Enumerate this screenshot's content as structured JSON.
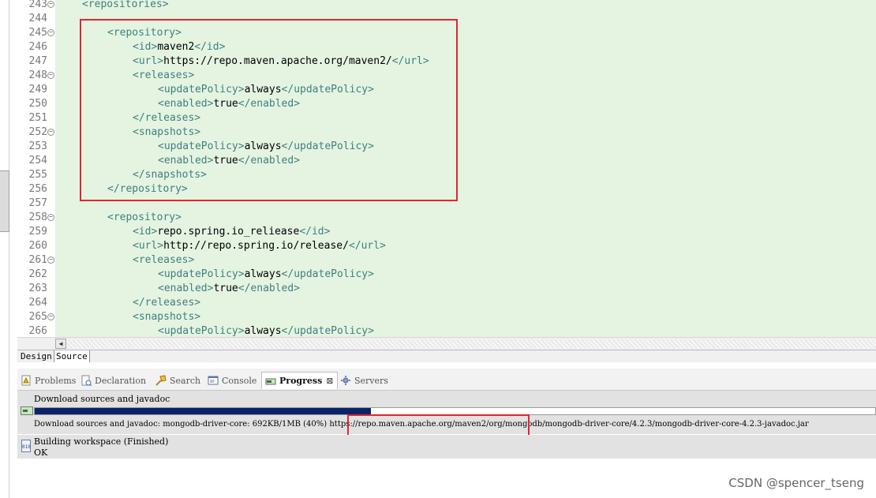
{
  "editor": {
    "lines": [
      {
        "n": "243",
        "fold": true,
        "indent": 0,
        "parts": [
          [
            "tag",
            "<repositories>"
          ]
        ]
      },
      {
        "n": "244",
        "fold": false,
        "indent": 0,
        "parts": []
      },
      {
        "n": "245",
        "fold": true,
        "indent": 1,
        "parts": [
          [
            "tag",
            "<repository>"
          ]
        ]
      },
      {
        "n": "246",
        "fold": false,
        "indent": 2,
        "parts": [
          [
            "tag",
            "<id>"
          ],
          [
            "txt",
            "maven2"
          ],
          [
            "tag",
            "</id>"
          ]
        ]
      },
      {
        "n": "247",
        "fold": false,
        "indent": 2,
        "parts": [
          [
            "tag",
            "<url>"
          ],
          [
            "txt",
            "https://repo.maven.apache.org/maven2/"
          ],
          [
            "tag",
            "</url>"
          ]
        ]
      },
      {
        "n": "248",
        "fold": true,
        "indent": 2,
        "parts": [
          [
            "tag",
            "<releases>"
          ]
        ]
      },
      {
        "n": "249",
        "fold": false,
        "indent": 3,
        "parts": [
          [
            "tag",
            "<updatePolicy>"
          ],
          [
            "txt",
            "always"
          ],
          [
            "tag",
            "</updatePolicy>"
          ]
        ]
      },
      {
        "n": "250",
        "fold": false,
        "indent": 3,
        "parts": [
          [
            "tag",
            "<enabled>"
          ],
          [
            "txt",
            "true"
          ],
          [
            "tag",
            "</enabled>"
          ]
        ]
      },
      {
        "n": "251",
        "fold": false,
        "indent": 2,
        "parts": [
          [
            "tag",
            "</releases>"
          ]
        ]
      },
      {
        "n": "252",
        "fold": true,
        "indent": 2,
        "parts": [
          [
            "tag",
            "<snapshots>"
          ]
        ]
      },
      {
        "n": "253",
        "fold": false,
        "indent": 3,
        "parts": [
          [
            "tag",
            "<updatePolicy>"
          ],
          [
            "txt",
            "always"
          ],
          [
            "tag",
            "</updatePolicy>"
          ]
        ]
      },
      {
        "n": "254",
        "fold": false,
        "indent": 3,
        "parts": [
          [
            "tag",
            "<enabled>"
          ],
          [
            "txt",
            "true"
          ],
          [
            "tag",
            "</enabled>"
          ]
        ]
      },
      {
        "n": "255",
        "fold": false,
        "indent": 2,
        "parts": [
          [
            "tag",
            "</snapshots>"
          ]
        ]
      },
      {
        "n": "256",
        "fold": false,
        "indent": 1,
        "parts": [
          [
            "tag",
            "</repository>"
          ]
        ]
      },
      {
        "n": "257",
        "fold": false,
        "indent": 0,
        "parts": []
      },
      {
        "n": "258",
        "fold": true,
        "indent": 1,
        "parts": [
          [
            "tag",
            "<repository>"
          ]
        ]
      },
      {
        "n": "259",
        "fold": false,
        "indent": 2,
        "parts": [
          [
            "tag",
            "<id>"
          ],
          [
            "txt",
            "repo.spring.io_reliease"
          ],
          [
            "tag",
            "</id>"
          ]
        ]
      },
      {
        "n": "260",
        "fold": false,
        "indent": 2,
        "parts": [
          [
            "tag",
            "<url>"
          ],
          [
            "txt",
            "http://repo.spring.io/release/"
          ],
          [
            "tag",
            "</url>"
          ]
        ]
      },
      {
        "n": "261",
        "fold": true,
        "indent": 2,
        "parts": [
          [
            "tag",
            "<releases>"
          ]
        ]
      },
      {
        "n": "262",
        "fold": false,
        "indent": 3,
        "parts": [
          [
            "tag",
            "<updatePolicy>"
          ],
          [
            "txt",
            "always"
          ],
          [
            "tag",
            "</updatePolicy>"
          ]
        ]
      },
      {
        "n": "263",
        "fold": false,
        "indent": 3,
        "parts": [
          [
            "tag",
            "<enabled>"
          ],
          [
            "txt",
            "true"
          ],
          [
            "tag",
            "</enabled>"
          ]
        ]
      },
      {
        "n": "264",
        "fold": false,
        "indent": 2,
        "parts": [
          [
            "tag",
            "</releases>"
          ]
        ]
      },
      {
        "n": "265",
        "fold": true,
        "indent": 2,
        "parts": [
          [
            "tag",
            "<snapshots>"
          ]
        ]
      },
      {
        "n": "266",
        "fold": false,
        "indent": 3,
        "parts": [
          [
            "tag",
            "<updatePolicy>"
          ],
          [
            "txt",
            "always"
          ],
          [
            "tag",
            "</updatePolicy>"
          ]
        ]
      }
    ]
  },
  "editor_tabs": {
    "design": "Design",
    "source": "Source"
  },
  "views": {
    "problems": "Problems",
    "declaration": "Declaration",
    "search": "Search",
    "console": "Console",
    "progress": "Progress",
    "progress_close": "⊠",
    "servers": "Servers"
  },
  "progress": {
    "job1_title": "Download sources and javadoc",
    "job1_progress": 0.4,
    "job1_status": "Download sources and javadoc: mongodb-driver-core: 692KB/1MB (40%) https://repo.maven.apache.org/maven2/org/mongodb/mongodb-driver-core/4.2.3/mongodb-driver-core-4.2.3-javadoc.jar",
    "job2_icon_text": "010",
    "job2_title": "Building workspace (Finished)",
    "job2_status": "OK"
  },
  "watermark": "CSDN @spencer_tseng",
  "colors": {
    "editor_bg": "#e4f4e1",
    "tag": "#3f7f7f",
    "highlight": "#e0262f",
    "progress_fill": "#0a246a"
  }
}
